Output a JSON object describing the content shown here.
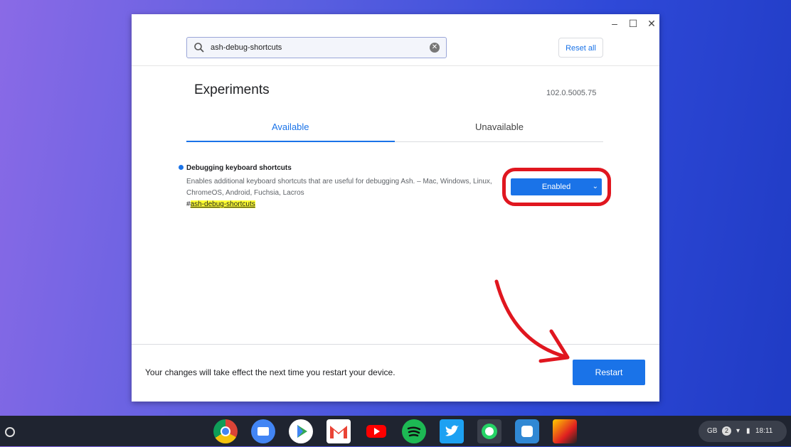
{
  "window_controls": {
    "minimize": "–",
    "maximize": "☐",
    "close": "✕"
  },
  "search": {
    "value": "ash-debug-shortcuts",
    "clear_icon": "clear-icon"
  },
  "reset_all_label": "Reset all",
  "page_title": "Experiments",
  "version": "102.0.5005.75",
  "tabs": [
    {
      "label": "Available",
      "active": true
    },
    {
      "label": "Unavailable",
      "active": false
    }
  ],
  "experiment": {
    "title": "Debugging keyboard shortcuts",
    "description": "Enables additional keyboard shortcuts that are useful for debugging Ash. – Mac, Windows, Linux, ChromeOS, Android, Fuchsia, Lacros",
    "tag_prefix": "#",
    "tag": "ash-debug-shortcuts",
    "selected_option": "Enabled"
  },
  "footer": {
    "message": "Your changes will take effect the next time you restart your device.",
    "restart_label": "Restart"
  },
  "shelf": {
    "apps": [
      "chrome",
      "files",
      "play-store",
      "gmail",
      "youtube",
      "spotify",
      "twitter",
      "whatsapp",
      "mastodon",
      "game"
    ],
    "tray": {
      "keyboard": "GB",
      "notifications": "2",
      "time": "18:11"
    }
  },
  "colors": {
    "accent": "#1a73e8",
    "annotation": "#e0161f",
    "highlight": "#ffff33"
  }
}
